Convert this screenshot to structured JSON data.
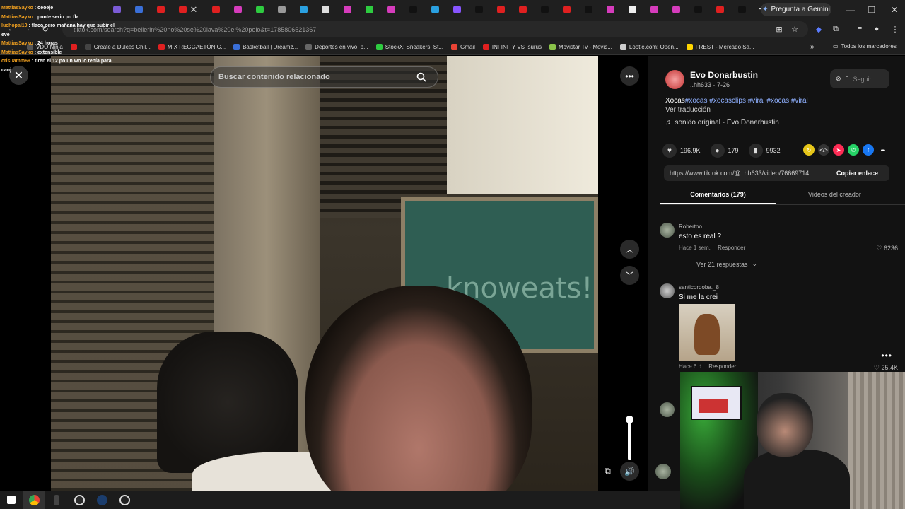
{
  "browser": {
    "gemini_label": "Pregunta a Gemini",
    "url": "tiktok.com/search?q=bellerin%20no%20se%20lava%20el%20pelo&t=1785806521367",
    "tab_favicons": [
      "#7b5bd6",
      "#3a6fd8",
      "#e02020",
      "#e02020",
      "#e02020",
      "#d63cbc",
      "#2ecc40",
      "#999999",
      "#2aa0e0",
      "#dddddd",
      "#d63cbc",
      "#2ecc40",
      "#d63cbc",
      "#111111",
      "#2aa0e0",
      "#8855ff",
      "#111111",
      "#e02020",
      "#e02020",
      "#111111",
      "#e02020",
      "#111111",
      "#d63cbc",
      "#eeeeee",
      "#d63cbc",
      "#d63cbc",
      "#111111",
      "#e02020",
      "#111111"
    ],
    "bookmarks": [
      {
        "label": "VDO.Ninja",
        "color": "#555555"
      },
      {
        "label": "",
        "color": "#e02020"
      },
      {
        "label": "Create a Dulces Chil...",
        "color": "#444444"
      },
      {
        "label": "MIX REGGAETÓN C...",
        "color": "#e02020"
      },
      {
        "label": "Basketball | Dreamz...",
        "color": "#3a6fd8"
      },
      {
        "label": "Deportes en vivo, p...",
        "color": "#666666"
      },
      {
        "label": "StockX: Sneakers, St...",
        "color": "#2ecc40"
      },
      {
        "label": "Gmail",
        "color": "#ea4335"
      },
      {
        "label": "INFINITY VS Isurus",
        "color": "#e02020"
      },
      {
        "label": "Movistar Tv - Movis...",
        "color": "#8bc34a"
      },
      {
        "label": "Lootie.com: Open...",
        "color": "#cccccc"
      },
      {
        "label": "FREST - Mercado Sa...",
        "color": "#ffd600"
      }
    ],
    "all_bookmarks": "Todos los marcadores"
  },
  "chat": [
    {
      "user": "MattiasSayko",
      "msg": ": oeoeje"
    },
    {
      "user": "MattiasSayko",
      "msg": ": ponte serio po fla"
    },
    {
      "user": "luchopal10",
      "msg": ": flaco pero mañana hay que subir el eve"
    },
    {
      "user": "MattiasSayko",
      "msg": ": 24 horas"
    },
    {
      "user": "MattiasSayko",
      "msg": ": extensible"
    },
    {
      "user": "crisuamm69",
      "msg": ": tiren el 12 po un wn lo tenía para canj"
    }
  ],
  "search": {
    "placeholder": "Buscar contenido relacionado"
  },
  "post": {
    "author": "Evo Donarbustin",
    "handle": "..hh633 · 7-26",
    "caption_text": "Xocas",
    "caption_tags": "#xocas #xocasclips #viral #xocas #viral",
    "translate": "Ver traducción",
    "sound": "sonido original - Evo Donarbustin",
    "follow": "Seguir",
    "likes": "196.9K",
    "comments": "179",
    "saves": "9932",
    "link": "https://www.tiktok.com/@..hh633/video/76669714...",
    "copy_link": "Copiar enlace"
  },
  "tabs": {
    "comments": "Comentarios (179)",
    "creator_videos": "Videos del creador"
  },
  "comments": [
    {
      "user": "Robertoo",
      "text": "esto es real ?",
      "time": "Hace 1 sem.",
      "reply": "Responder",
      "likes": "6236",
      "replies": "Ver 21 respuestas"
    },
    {
      "user": "santicordoba._8",
      "text": "Si me la crei",
      "time": "Hace 6 d",
      "reply": "Responder",
      "likes": "25.4K"
    }
  ]
}
